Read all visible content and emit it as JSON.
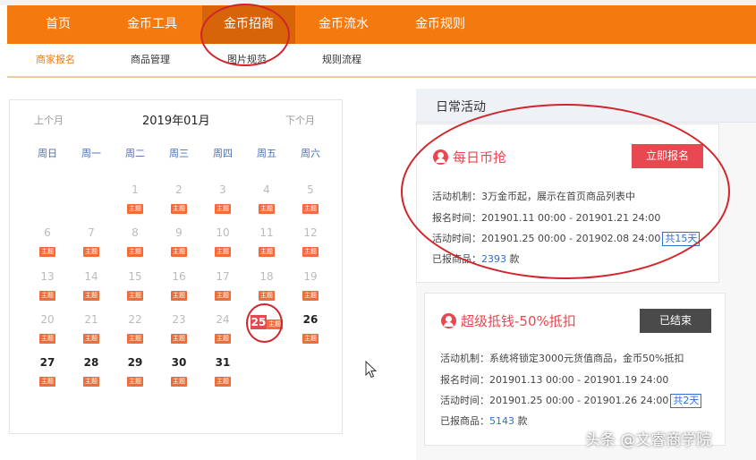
{
  "nav": {
    "items": [
      "首页",
      "金币工具",
      "金币招商",
      "金币流水",
      "金币规则"
    ],
    "active": "金币招商"
  },
  "subnav": {
    "items": [
      "商家报名",
      "商品管理",
      "图片规范",
      "规则流程"
    ],
    "active": "商家报名"
  },
  "calendar": {
    "prev": "上个月",
    "next": "下个月",
    "title": "2019年01月",
    "weekdays": [
      "周日",
      "周一",
      "周二",
      "周三",
      "周四",
      "周五",
      "周六"
    ],
    "tag": "主题",
    "days": [
      "1",
      "2",
      "3",
      "4",
      "5",
      "6",
      "7",
      "8",
      "9",
      "10",
      "11",
      "12",
      "13",
      "14",
      "15",
      "16",
      "17",
      "18",
      "19",
      "20",
      "21",
      "22",
      "23",
      "24",
      "25",
      "26",
      "27",
      "28",
      "29",
      "30",
      "31"
    ],
    "today": "25"
  },
  "activity": {
    "header": "日常活动",
    "cards": [
      {
        "title": "每日币抢",
        "button": "立即报名",
        "mechanism": "活动机制：3万金币起，展示在首页商品列表中",
        "signup": "报名时间：201901.11 00:00 - 201901.21 24:00",
        "period": "活动时间：201901.25 00:00 - 201902.08 24:00",
        "days": "共15天",
        "goods_label": "已报商品：",
        "goods_count": "2393",
        "goods_unit": " 款"
      },
      {
        "title": "超级抵钱-50%抵扣",
        "button": "已结束",
        "mechanism": "活动机制：系统将锁定3000元货值商品，金币50%抵扣",
        "signup": "报名时间：201901.13 00:00 - 201901.19 24:00",
        "period": "活动时间：201901.25 00:00 - 201901.26 24:00",
        "days": "共2天",
        "goods_label": "已报商品：",
        "goods_count": "5143",
        "goods_unit": " 款"
      }
    ]
  },
  "watermark": "头条 @文睿商学院",
  "colors": {
    "brand_orange": "#f47a0f",
    "tag_red": "#f46a3c",
    "annotation_red": "#d0252a",
    "link_blue": "#2d6fd3"
  }
}
